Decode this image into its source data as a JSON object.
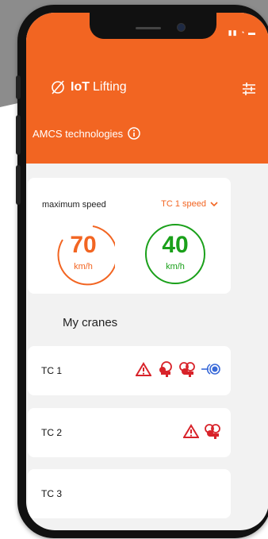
{
  "header": {
    "brand": "IoT",
    "brand_sub": "Lifting",
    "company": "AMCS technologies"
  },
  "speed": {
    "label": "maximum speed",
    "selected": "TC 1 speed",
    "gauges": [
      {
        "value": "70",
        "unit": "km/h",
        "color": "#f26522"
      },
      {
        "value": "40",
        "unit": "km/h",
        "color": "#1aa01a"
      }
    ]
  },
  "cranes_title": "My cranes",
  "cranes": [
    {
      "name": "TC 1",
      "icons": [
        "warning-icon",
        "overload-key-icon",
        "inspection-key-icon",
        "connection-icon"
      ]
    },
    {
      "name": "TC 2",
      "icons": [
        "warning-icon",
        "inspection-key-icon"
      ]
    },
    {
      "name": "TC 3",
      "icons": []
    }
  ],
  "colors": {
    "accent": "#f26522",
    "ok": "#1aa01a",
    "alert": "#d8232a",
    "link": "#3a6ad8"
  }
}
